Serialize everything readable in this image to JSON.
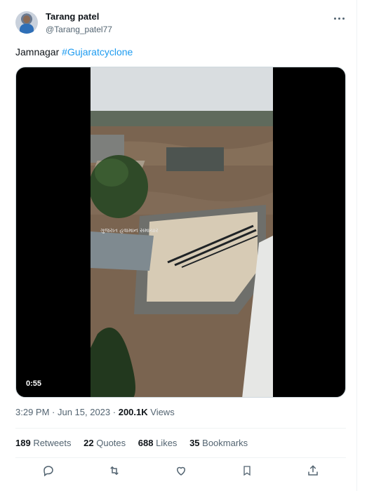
{
  "tweet": {
    "author_name": "Tarang patel",
    "author_handle": "@Tarang_patel77",
    "text_plain": "Jamnagar ",
    "text_hashtag": "#Gujaratcyclone",
    "video_duration": "0:55",
    "video_overlay_text": "ગુજરાત હવામાન સમાચાર",
    "timestamp": "3:29 PM · Jun 15, 2023",
    "views_dot": " · ",
    "views_count": "200.1K",
    "views_label": " Views",
    "retweets_count": "189",
    "retweets_label": " Retweets",
    "quotes_count": "22",
    "quotes_label": " Quotes",
    "likes_count": "688",
    "likes_label": " Likes",
    "bookmarks_count": "35",
    "bookmarks_label": " Bookmarks"
  },
  "icons": [
    "more-icon",
    "reply-icon",
    "retweet-icon",
    "like-icon",
    "bookmark-icon",
    "share-icon"
  ],
  "colors": {
    "accent": "#1d9bf0",
    "secondary_text": "#536471",
    "primary_text": "#0f1419"
  }
}
